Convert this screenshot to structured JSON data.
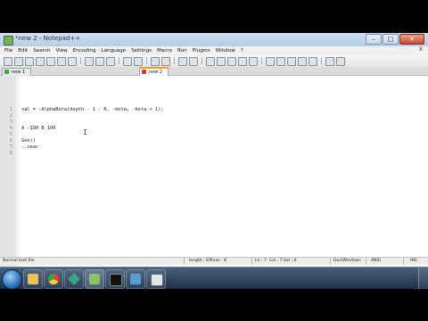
{
  "window": {
    "title": "*new 2 - Notepad++",
    "minimize_glyph": "–",
    "maximize_glyph": "□",
    "close_glyph": "✕",
    "menu_close_glyph": "X"
  },
  "menu": {
    "items": [
      "File",
      "Edit",
      "Search",
      "View",
      "Encoding",
      "Language",
      "Settings",
      "Macro",
      "Run",
      "Plugins",
      "Window",
      "?"
    ]
  },
  "tabs": [
    {
      "label": "new 1",
      "active": false
    },
    {
      "label": "new 2",
      "active": true
    }
  ],
  "editor": {
    "lines": [
      {
        "number": "1",
        "text": "val = -AlphaBeta(depth - 1 - R, -beta, -beta + 1);"
      },
      {
        "number": "2",
        "text": ""
      },
      {
        "number": "3",
        "text": ""
      },
      {
        "number": "4",
        "text": "A -100 B 100"
      },
      {
        "number": "5",
        "text": ""
      },
      {
        "number": "6",
        "text": "Gen()"
      },
      {
        "number": "7",
        "text": "..seac"
      },
      {
        "number": "8",
        "text": ""
      }
    ]
  },
  "statusbar": {
    "file_type": "Normal text file",
    "length": "length : 87",
    "lines": "lines : 8",
    "ln": "Ln : 7",
    "col": "Col : 7",
    "sel": "Sel : 0",
    "eol": "Dos\\Windows",
    "encoding": "ANSI",
    "mode": "INS"
  },
  "taskbar": {
    "apps": [
      "explorer",
      "chrome",
      "app-3",
      "notepadpp",
      "terminal",
      "app-6",
      "calculator"
    ]
  },
  "colors": {
    "active_tab_accent": "#f39a21",
    "taskbar": "#2a3f58"
  }
}
